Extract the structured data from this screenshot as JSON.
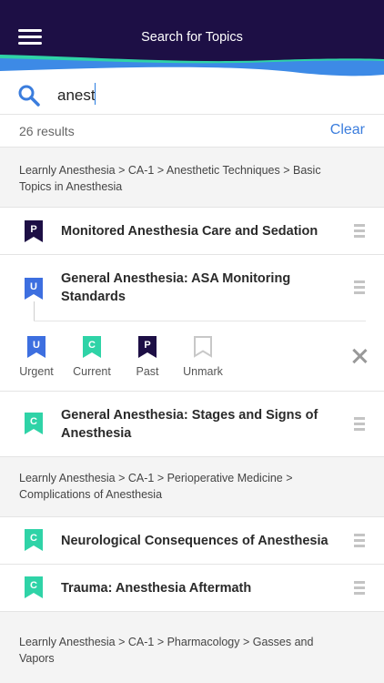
{
  "header": {
    "title": "Search for Topics",
    "menu_icon": "hamburger-menu-icon"
  },
  "search": {
    "value": "anest",
    "placeholder": ""
  },
  "results": {
    "count_label": "26 results",
    "clear_label": "Clear"
  },
  "colors": {
    "urgent": "#3d6fe0",
    "current": "#2fd3a7",
    "past": "#1d0f45",
    "unmark": "#c8c8c8",
    "accent": "#3b7ddd",
    "header": "#1d0f45"
  },
  "groups": [
    {
      "breadcrumb": "Learnly Anesthesia > CA-1 > Anesthetic Techniques > Basic Topics in Anesthesia",
      "topics": [
        {
          "title": "Monitored Anesthesia Care and Sedation",
          "mark": "P",
          "status": "past"
        },
        {
          "title": "General Anesthesia: ASA Monitoring Standards",
          "mark": "U",
          "status": "urgent"
        },
        {
          "title": "General Anesthesia: Stages and Signs of Anesthesia",
          "mark": "C",
          "status": "current"
        }
      ]
    },
    {
      "breadcrumb": "Learnly Anesthesia > CA-1 > Perioperative Medicine > Complications of Anesthesia",
      "topics": [
        {
          "title": "Neurological Consequences of Anesthesia",
          "mark": "C",
          "status": "current"
        },
        {
          "title": "Trauma: Anesthesia Aftermath",
          "mark": "C",
          "status": "current"
        }
      ]
    },
    {
      "breadcrumb": "Learnly Anesthesia > CA-1 > Pharmacology > Gasses and Vapors",
      "topics": []
    }
  ],
  "mark_options": [
    {
      "letter": "U",
      "label": "Urgent"
    },
    {
      "letter": "C",
      "label": "Current"
    },
    {
      "letter": "P",
      "label": "Past"
    },
    {
      "letter": "",
      "label": "Unmark"
    }
  ]
}
